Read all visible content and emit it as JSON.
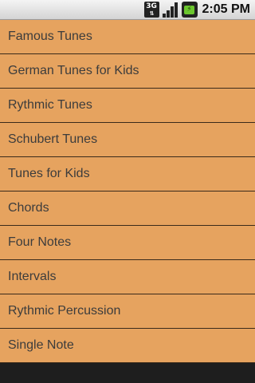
{
  "status_bar": {
    "network_label": "3G",
    "network_arrows": "⇅",
    "battery_label": "⚡",
    "time": "2:05 PM",
    "signal_bars": 4
  },
  "menu": {
    "items": [
      {
        "label": "Famous Tunes"
      },
      {
        "label": "German Tunes for Kids"
      },
      {
        "label": "Rythmic Tunes"
      },
      {
        "label": "Schubert Tunes"
      },
      {
        "label": "Tunes for Kids"
      },
      {
        "label": "Chords"
      },
      {
        "label": "Four Notes"
      },
      {
        "label": "Intervals"
      },
      {
        "label": "Rythmic Percussion"
      },
      {
        "label": "Single Note"
      }
    ]
  },
  "colors": {
    "list_background": "#e6a35f",
    "divider": "#3a2a1a",
    "text": "#3c3c3c"
  }
}
